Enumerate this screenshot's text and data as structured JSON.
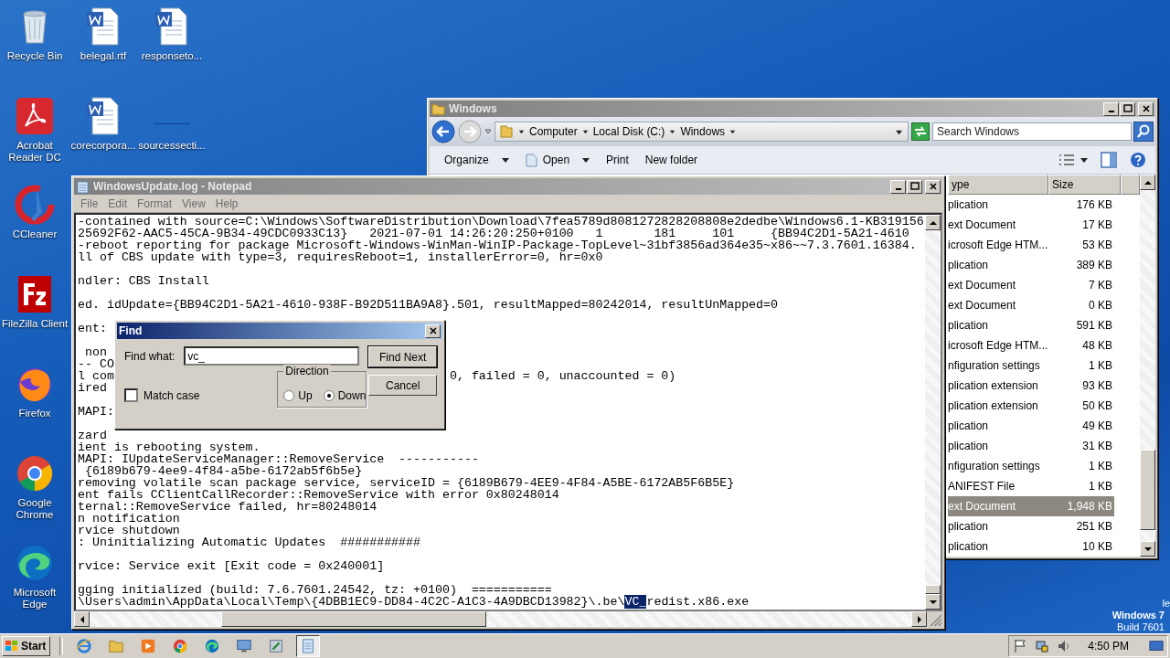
{
  "desktop_icons": [
    {
      "label": "Recycle Bin",
      "kind": "recycle"
    },
    {
      "label": "belegal.rtf",
      "kind": "word"
    },
    {
      "label": "responseto...",
      "kind": "word"
    },
    {
      "label": "Acrobat Reader DC",
      "kind": "acrobat"
    },
    {
      "label": "corecorpora...",
      "kind": "word"
    },
    {
      "label": "sourcessecti...",
      "kind": "blank"
    },
    {
      "label": "CCleaner",
      "kind": "ccleaner"
    },
    {
      "label": "FileZilla Client",
      "kind": "filezilla"
    },
    {
      "label": "Firefox",
      "kind": "firefox"
    },
    {
      "label": "Google Chrome",
      "kind": "chrome"
    },
    {
      "label": "Microsoft Edge",
      "kind": "edge"
    }
  ],
  "explorer": {
    "title": "Windows",
    "breadcrumbs": [
      "Computer",
      "Local Disk (C:)",
      "Windows"
    ],
    "search": {
      "placeholder": "Search Windows"
    },
    "toolbar": [
      "Organize",
      "Open",
      "Print",
      "New folder"
    ],
    "columns": [
      "ype",
      "Size"
    ],
    "rows": [
      {
        "type": "plication",
        "size": "176 KB",
        "selected": false
      },
      {
        "type": "ext Document",
        "size": "17 KB",
        "selected": false
      },
      {
        "type": "icrosoft Edge HTM...",
        "size": "53 KB",
        "selected": false
      },
      {
        "type": "plication",
        "size": "389 KB",
        "selected": false
      },
      {
        "type": "ext Document",
        "size": "7 KB",
        "selected": false
      },
      {
        "type": "ext Document",
        "size": "0 KB",
        "selected": false
      },
      {
        "type": "plication",
        "size": "591 KB",
        "selected": false
      },
      {
        "type": "icrosoft Edge HTM...",
        "size": "48 KB",
        "selected": false
      },
      {
        "type": "nfiguration settings",
        "size": "1 KB",
        "selected": false
      },
      {
        "type": "plication extension",
        "size": "93 KB",
        "selected": false
      },
      {
        "type": "plication extension",
        "size": "50 KB",
        "selected": false
      },
      {
        "type": "plication",
        "size": "49 KB",
        "selected": false
      },
      {
        "type": "plication",
        "size": "31 KB",
        "selected": false
      },
      {
        "type": "nfiguration settings",
        "size": "1 KB",
        "selected": false
      },
      {
        "type": "ANIFEST File",
        "size": "1 KB",
        "selected": false
      },
      {
        "type": "ext Document",
        "size": "1,948 KB",
        "selected": true
      },
      {
        "type": "plication",
        "size": "251 KB",
        "selected": false
      },
      {
        "type": "plication",
        "size": "10 KB",
        "selected": false
      }
    ]
  },
  "notepad": {
    "title": "WindowsUpdate.log - Notepad",
    "menu": [
      "File",
      "Edit",
      "Format",
      "View",
      "Help"
    ],
    "lines": [
      {
        "kind": "text",
        "text": "-contained with source=C:\\Windows\\SoftwareDistribution\\Download\\7fea5789d8081272828208808e2dedbe\\Windows6.1-KB319156"
      },
      {
        "kind": "text",
        "text": "25692F62-AAC5-45CA-9B34-49CDC0933C13}   2021-07-01 14:26:20:250+0100   1       181     101     {BB94C2D1-5A21-4610"
      },
      {
        "kind": "text",
        "text": "-reboot reporting for package Microsoft-Windows-WinMan-WinIP-Package-TopLevel~31bf3856ad364e35~x86~~7.3.7601.16384."
      },
      {
        "kind": "text",
        "text": "ll of CBS update with type=3, requiresReboot=1, installerError=0, hr=0x0"
      },
      {
        "kind": "blank"
      },
      {
        "kind": "text",
        "text": "ndler: CBS Install"
      },
      {
        "kind": "blank"
      },
      {
        "kind": "text",
        "text": "ed. idUpdate={BB94C2D1-5A21-4610-938F-B92D511BA9A8}.501, resultMapped=80242014, resultUnMapped=0"
      },
      {
        "kind": "blank"
      },
      {
        "kind": "text",
        "text": "ent:"
      },
      {
        "kind": "blank"
      },
      {
        "kind": "text",
        "text": " non"
      },
      {
        "kind": "text",
        "text": "-- CO"
      },
      {
        "kind": "split",
        "text": "l com",
        "tail": "0, failed = 0, unaccounted = 0)"
      },
      {
        "kind": "text",
        "text": "ired"
      },
      {
        "kind": "blank"
      },
      {
        "kind": "text",
        "text": "MAPI:"
      },
      {
        "kind": "blank"
      },
      {
        "kind": "text",
        "text": "zard"
      },
      {
        "kind": "text",
        "text": "ient is rebooting system."
      },
      {
        "kind": "text",
        "text": "MAPI: IUpdateServiceManager::RemoveService  -----------"
      },
      {
        "kind": "text",
        "text": " {6189b679-4ee9-4f84-a5be-6172ab5f6b5e}"
      },
      {
        "kind": "text",
        "text": "removing volatile scan package service, serviceID = {6189B679-4EE9-4F84-A5BE-6172AB5F6B5E}"
      },
      {
        "kind": "text",
        "text": "ent fails CClientCallRecorder::RemoveService with error 0x80248014"
      },
      {
        "kind": "text",
        "text": "ternal::RemoveService failed, hr=80248014"
      },
      {
        "kind": "text",
        "text": "n notification"
      },
      {
        "kind": "text",
        "text": "rvice shutdown"
      },
      {
        "kind": "text",
        "text": ": Uninitializing Automatic Updates  ###########"
      },
      {
        "kind": "blank"
      },
      {
        "kind": "text",
        "text": "rvice: Service exit [Exit code = 0x240001]"
      },
      {
        "kind": "blank"
      },
      {
        "kind": "text",
        "text": "gging initialized (build: 7.6.7601.24542, tz: +0100)  ==========="
      },
      {
        "kind": "match",
        "text": "\\Users\\admin\\AppData\\Local\\Temp\\{4DBB1EC9-DD84-4C2C-A1C3-4A9DBCD13982}\\.be\\",
        "match": "VC_",
        "after": "redist.x86.exe"
      }
    ]
  },
  "find_dialog": {
    "title": "Find",
    "find_what_label": "Find what:",
    "value": "vc_",
    "buttons": [
      "Find Next",
      "Cancel"
    ],
    "match_case": {
      "label": "Match case",
      "checked": false
    },
    "direction": {
      "label": "Direction",
      "options": [
        {
          "label": "Up",
          "selected": false
        },
        {
          "label": "Down",
          "selected": true
        }
      ]
    }
  },
  "desktop_text": [
    "le",
    "Windows 7",
    "Build 7601"
  ],
  "taskbar": {
    "start": "Start",
    "apps": [
      {
        "kind": "ie",
        "selected": false
      },
      {
        "kind": "folder",
        "selected": false
      },
      {
        "kind": "media",
        "selected": false
      },
      {
        "kind": "chrome",
        "selected": false
      },
      {
        "kind": "edge",
        "selected": false
      },
      {
        "kind": "panel",
        "selected": false
      },
      {
        "kind": "tool",
        "selected": false
      },
      {
        "kind": "notepad",
        "selected": true
      }
    ],
    "clock": "4:50 PM"
  }
}
